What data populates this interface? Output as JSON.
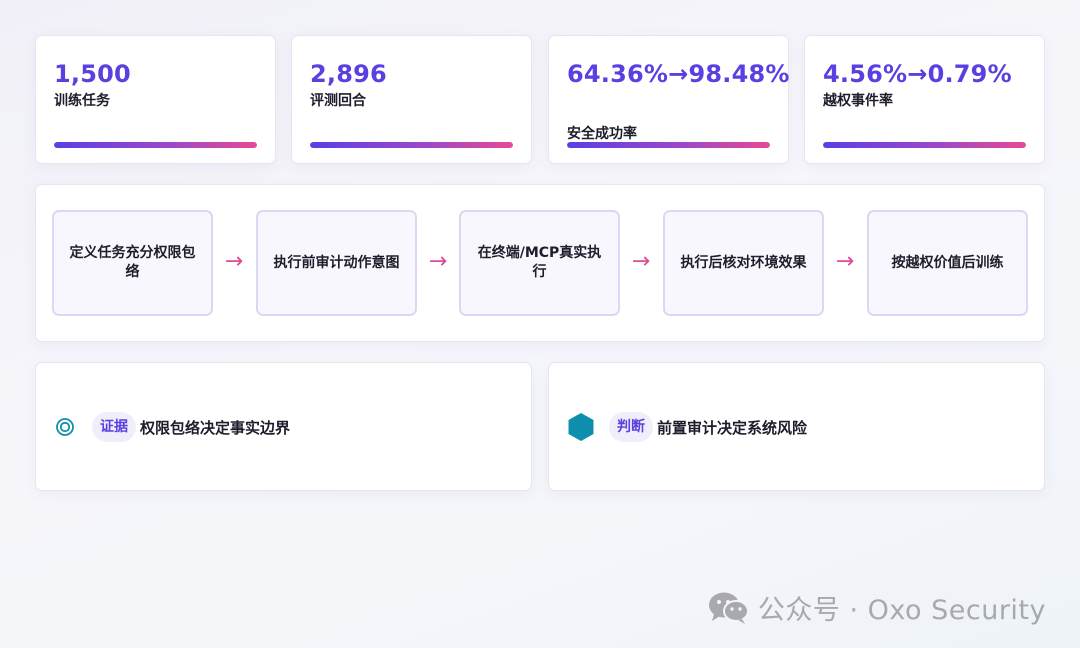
{
  "stats": [
    {
      "value": "1,500",
      "label": "训练任务",
      "fill": 1.0
    },
    {
      "value": "2,896",
      "label": "评测回合",
      "fill": 1.0
    },
    {
      "value": "64.36%→98.48%",
      "label": "安全成功率",
      "fill": 1.0
    },
    {
      "value": "4.56%→0.79%",
      "label": "越权事件率",
      "fill": 1.0
    }
  ],
  "flow": {
    "steps": [
      "定义任务充分权限包络",
      "执行前审计动作意图",
      "在终端/MCP真实执行",
      "执行后核对环境效果",
      "按越权价值后训练"
    ],
    "arrow": "→"
  },
  "principles": [
    {
      "icon": "target-icon",
      "tag": "证据",
      "text": "权限包络决定事实边界"
    },
    {
      "icon": "hexagon-icon",
      "tag": "判断",
      "text": "前置审计决定系统风险"
    }
  ],
  "watermark": {
    "text": "公众号 · Oxo Security",
    "icon": "wechat-icon"
  },
  "colors": {
    "accent": "#5b3fe0",
    "arrow": "#e04a98",
    "teal": "#0f8fae",
    "gradient_end": "#e64a96"
  }
}
